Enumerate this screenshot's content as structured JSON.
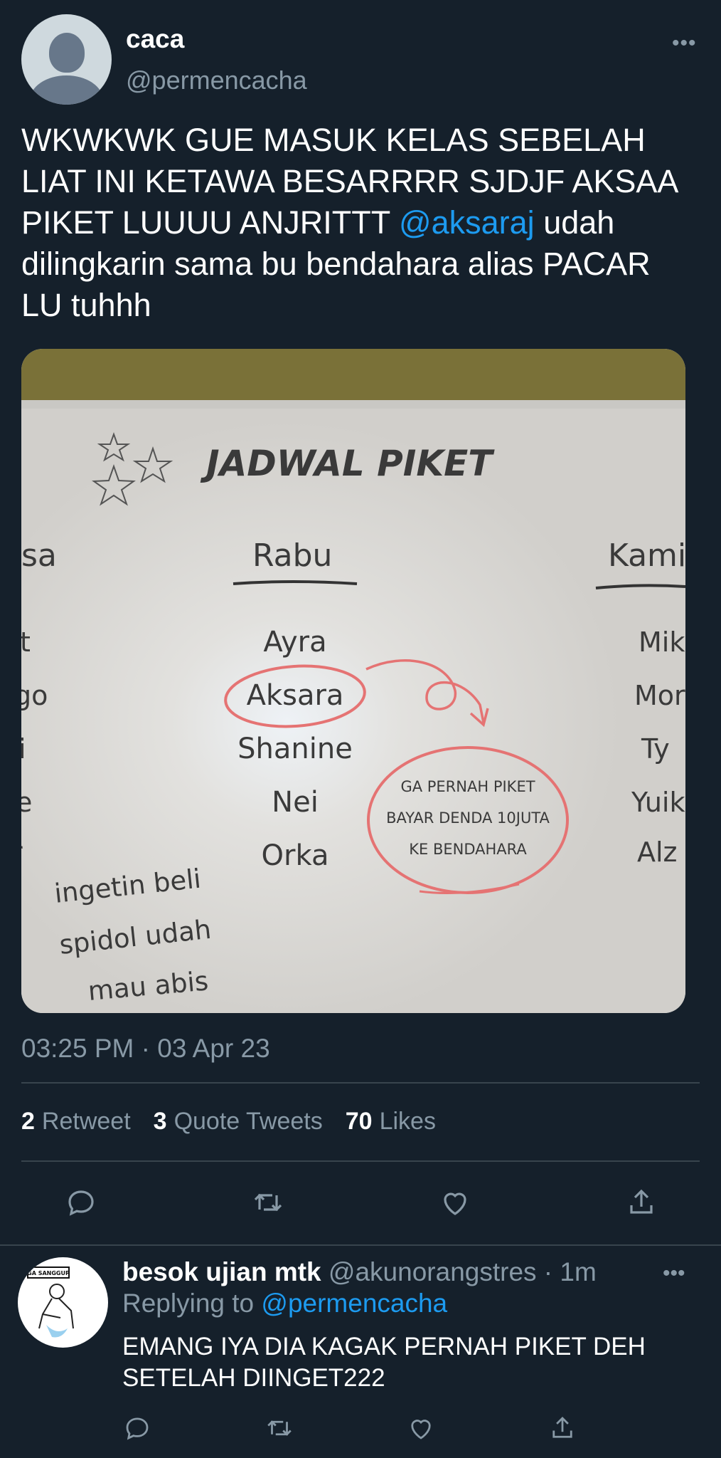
{
  "tweet": {
    "display_name": "caca",
    "handle": "@permencacha",
    "more_icon": "more-horizontal-icon",
    "text_parts": [
      "WKWKWK GUE MASUK KELAS SEBELAH LIAT INI KETAWA BESARRRR SJDJF AKSAA PIKET LUUUU ANJRITTT ",
      "@aksaraj",
      " udah dilingkarin sama bu bendahara alias PACAR LU tuhhh"
    ],
    "timestamp": "03:25 PM · 03 Apr 23",
    "stats": {
      "retweets_count": "2",
      "retweets_label": "Retweet",
      "quotes_count": "3",
      "quotes_label": "Quote Tweets",
      "likes_count": "70",
      "likes_label": "Likes"
    },
    "actions": [
      "reply-icon",
      "retweet-icon",
      "like-icon",
      "share-icon"
    ]
  },
  "photo": {
    "title": "JADWAL PIKET",
    "left_day": "sa",
    "center_day": "Rabu",
    "right_day": "Kami",
    "left_names": [
      "t",
      "go",
      "i",
      "e",
      "r"
    ],
    "center_names": [
      "Ayra",
      "Aksara",
      "Shanine",
      "Nei",
      "Orka"
    ],
    "right_names": [
      "Mik",
      "Mor",
      "Ty",
      "Yuik",
      "Alz"
    ],
    "note_lines": [
      "GA PERNAH PIKET",
      "BAYAR DENDA 10JUTA",
      "KE BENDAHARA"
    ],
    "reminder_lines": [
      "ingetin beli",
      "spidol udah",
      "mau abis"
    ],
    "ink_color": "#3a3a3a",
    "marker_red": "#e57373"
  },
  "reply": {
    "name": "besok ujian mtk",
    "meta": " @akunorangstres · 1m",
    "replying_label": "Replying to ",
    "replying_handle": "@permencacha",
    "text": "EMANG IYA DIA KAGAK PERNAH PIKET DEH SETELAH DIINGET222",
    "avatar_sign": "GA SANGGUP"
  },
  "colors": {
    "background": "#15202b",
    "text_primary": "#ffffff",
    "text_secondary": "#8899a6",
    "link": "#1d9bf0",
    "divider": "#38444d"
  }
}
